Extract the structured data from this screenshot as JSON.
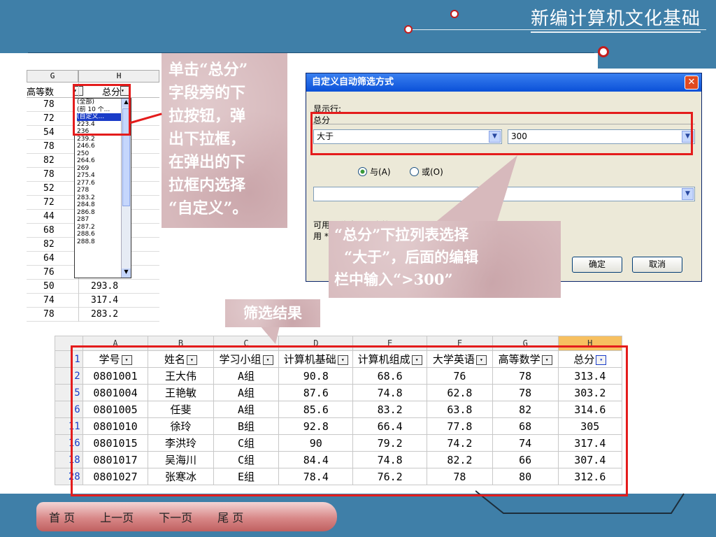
{
  "header": {
    "title": "新编计算机文化基础"
  },
  "colors": {
    "blue": "#3f7fa8",
    "red": "#e41c1c"
  },
  "sheet_top": {
    "col_g": "G",
    "col_h": "H",
    "hdr_g": "高等数",
    "hdr_h": "总分",
    "values": [
      "78",
      "72",
      "54",
      "78",
      "82",
      "78",
      "52",
      "72",
      "44",
      "68",
      "82",
      "64",
      "76",
      "50",
      "74",
      "78"
    ],
    "h_values": [
      "293.8",
      "317.4",
      "283.2"
    ],
    "dropdown": [
      "(全部)",
      "(前 10 个...",
      "(自定义...",
      "223.4",
      "236",
      "239.2",
      "246.6",
      "250",
      "264.6",
      "269",
      "275.4",
      "277.6",
      "278",
      "283.2",
      "284.8",
      "286.8",
      "287",
      "287.2",
      "288.6",
      "288.8"
    ]
  },
  "callouts": {
    "left": [
      "单击“总分”",
      "字段旁的下",
      "拉按钮，弹",
      "出下拉框，",
      "在弹出的下",
      "拉框内选择",
      "“自定义”。"
    ],
    "right": [
      "“总分”下拉列表选择",
      "“大于”，后面的编辑",
      "栏中输入“>300”"
    ],
    "result": "筛选结果"
  },
  "dialog": {
    "title": "自定义自动筛选方式",
    "show_rows": "显示行:",
    "field": "总分",
    "op1": "大于",
    "val1": "300",
    "and_label": "与(A)",
    "or_label": "或(O)",
    "hint1": "可用 ? 代表单个字符",
    "hint2": "用 * 代表任意多个字符",
    "ok": "确定",
    "cancel": "取消"
  },
  "sheet_bottom": {
    "cols": [
      "A",
      "B",
      "C",
      "D",
      "E",
      "F",
      "G",
      "H"
    ],
    "headers": [
      "学号",
      "姓名",
      "学习小组",
      "计算机基础",
      "计算机组成",
      "大学英语",
      "高等数学",
      "总分"
    ],
    "rows": [
      {
        "n": "2",
        "cells": [
          "0801001",
          "王大伟",
          "A组",
          "90.8",
          "68.6",
          "76",
          "78",
          "313.4"
        ]
      },
      {
        "n": "5",
        "cells": [
          "0801004",
          "王艳敏",
          "A组",
          "87.6",
          "74.8",
          "62.8",
          "78",
          "303.2"
        ]
      },
      {
        "n": "6",
        "cells": [
          "0801005",
          "任斐",
          "A组",
          "85.6",
          "83.2",
          "63.8",
          "82",
          "314.6"
        ]
      },
      {
        "n": "11",
        "cells": [
          "0801010",
          "徐玲",
          "B组",
          "92.8",
          "66.4",
          "77.8",
          "68",
          "305"
        ]
      },
      {
        "n": "16",
        "cells": [
          "0801015",
          "李洪玲",
          "C组",
          "90",
          "79.2",
          "74.2",
          "74",
          "317.4"
        ]
      },
      {
        "n": "18",
        "cells": [
          "0801017",
          "吴海川",
          "C组",
          "84.4",
          "74.8",
          "82.2",
          "66",
          "307.4"
        ]
      },
      {
        "n": "28",
        "cells": [
          "0801027",
          "张寒冰",
          "E组",
          "78.4",
          "76.2",
          "78",
          "80",
          "312.6"
        ]
      }
    ],
    "row1": "1"
  },
  "nav": [
    "首 页",
    "上一页",
    "下一页",
    "尾 页"
  ]
}
